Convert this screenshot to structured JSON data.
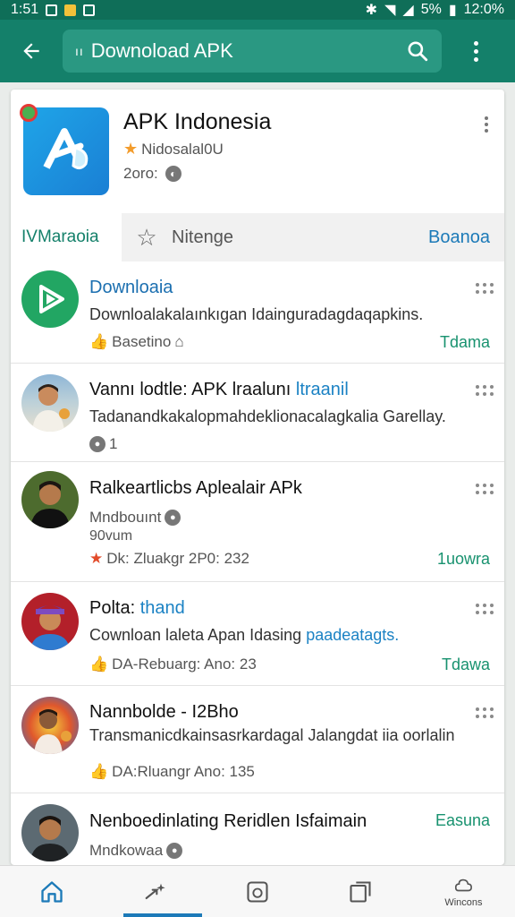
{
  "status_bar": {
    "time_left": "1:51",
    "battery": "5%",
    "clock": "12:0%"
  },
  "app_bar": {
    "search_prefix": "ıı",
    "search_query": "Downoload APK"
  },
  "app_header": {
    "name": "APK Indonesia",
    "rating_text": "Nidosalal0U",
    "meta_text": "2oro:"
  },
  "tabs": {
    "active": "IVMaraoia",
    "middle": "Nitenge",
    "right": "Boanoa"
  },
  "items": [
    {
      "title": "Downloaia",
      "desc": "Downloalakalaınkıgan Idainguradagdaqapkins.",
      "meta": "Basetino",
      "action": "Tdama"
    },
    {
      "title_main": "Vannı lodtle: APK lraalunı ",
      "title_accent": "ltraanil",
      "desc": "Tadanandkakalopmahdeklionacalagkalia Garellay.",
      "meta": "1"
    },
    {
      "title": "Ralkeartlicbs Aplealair APk",
      "sub1": "Mndbouınt",
      "sub2": "90vum",
      "meta": "Dk: Zluakgr 2P0: 232",
      "action": "1uowra"
    },
    {
      "title_main": "Polta: ",
      "title_accent": "thand",
      "desc_main": "Cownloan laleta Apan Idasing ",
      "desc_accent": "paadeatagts.",
      "meta": "DA-Rebuarg: Ano: 23",
      "action": "Tdawa"
    },
    {
      "title": "Nannbolde - I2Bho",
      "desc": "Transmanicdkainsasrkardagal Jalangdat iia oorlalin",
      "meta": "DA:Rluangr Ano: 135"
    },
    {
      "title": "Nenboedinlating Reridlen Isfaimain",
      "sub1": "Mndkowaa",
      "action": "Easuna"
    }
  ],
  "bottom_nav": {
    "item5_label": "Wincons"
  },
  "colors": {
    "primary": "#14806a",
    "status_bar": "#0f6e58",
    "accent_blue": "#1c7ab8",
    "action_green": "#18926f"
  }
}
